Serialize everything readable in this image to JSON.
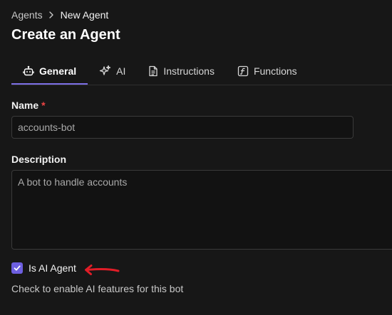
{
  "breadcrumb": {
    "parent": "Agents",
    "current": "New Agent"
  },
  "page": {
    "title": "Create an Agent"
  },
  "tabs": [
    {
      "label": "General",
      "icon": "bot-icon",
      "active": true
    },
    {
      "label": "AI",
      "icon": "sparkles-icon",
      "active": false
    },
    {
      "label": "Instructions",
      "icon": "document-icon",
      "active": false
    },
    {
      "label": "Functions",
      "icon": "function-icon",
      "active": false
    }
  ],
  "form": {
    "name": {
      "label": "Name",
      "required_marker": "*",
      "value": "accounts-bot"
    },
    "description": {
      "label": "Description",
      "value": "",
      "placeholder": "A bot to handle accounts"
    },
    "is_ai_agent": {
      "label": "Is AI Agent",
      "checked": true,
      "help": "Check to enable AI features for this bot"
    }
  },
  "colors": {
    "accent": "#7c6fe6",
    "checkbox": "#6d5fe0",
    "required": "#ef4444",
    "annotation_arrow": "#e11d27"
  }
}
